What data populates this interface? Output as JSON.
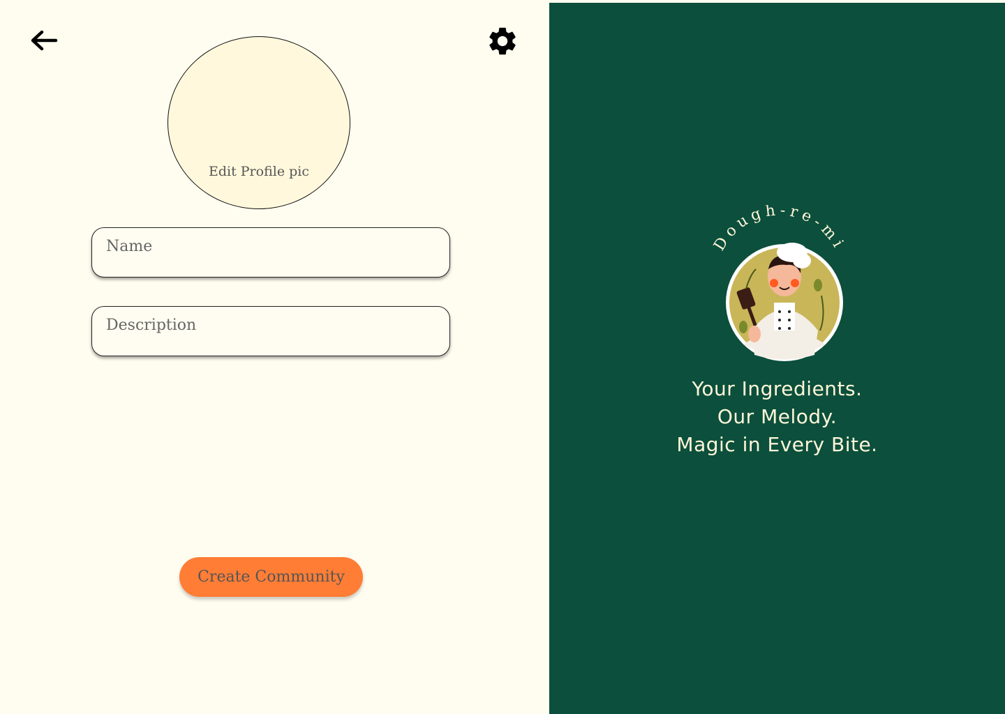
{
  "nav": {
    "back_icon": "arrow-left-icon",
    "settings_icon": "gear-icon"
  },
  "profile": {
    "edit_pic_label": "Edit Profile pic"
  },
  "form": {
    "name_placeholder": "Name",
    "description_placeholder": "Description"
  },
  "actions": {
    "create_label": "Create Community"
  },
  "brand": {
    "name": "Dough-re-mi",
    "logo_icon": "chef-logo-icon",
    "tagline_lines": [
      "Your Ingredients.",
      "Our Melody.",
      "Magic in Every Bite."
    ]
  },
  "colors": {
    "left_bg": "#fffdf0",
    "right_bg": "#0b4f3c",
    "accent": "#ff7d35",
    "avatar_bg": "#fff8dc"
  }
}
